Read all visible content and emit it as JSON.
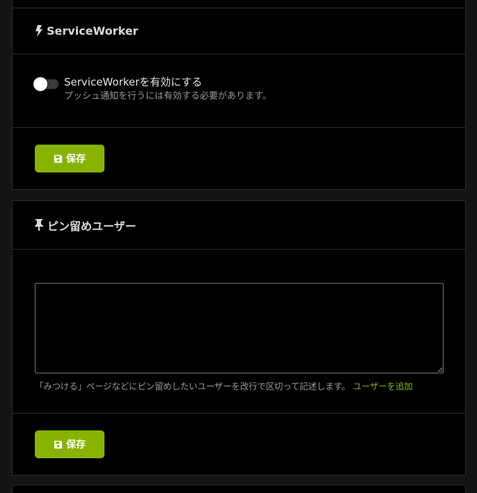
{
  "service_worker": {
    "title": "ServiceWorker",
    "title_icon": "bolt-icon",
    "toggle": {
      "label": "ServiceWorkerを有効にする",
      "caption": "プッシュ通知を行うには有効する必要があります。",
      "enabled": false
    },
    "save_label": "保存",
    "save_icon": "floppy-disk-icon"
  },
  "pinned_users": {
    "title": "ピン留めユーザー",
    "title_icon": "thumbtack-icon",
    "textarea_value": "",
    "help_text": "「みつける」ページなどにピン留めしたいユーザーを改行で区切って記述します。",
    "add_user_link": "ユーザーを追加",
    "save_label": "保存",
    "save_icon": "floppy-disk-icon"
  },
  "colors": {
    "accent": "#86b300",
    "background": "#000000",
    "border": "#2e2e2e"
  }
}
